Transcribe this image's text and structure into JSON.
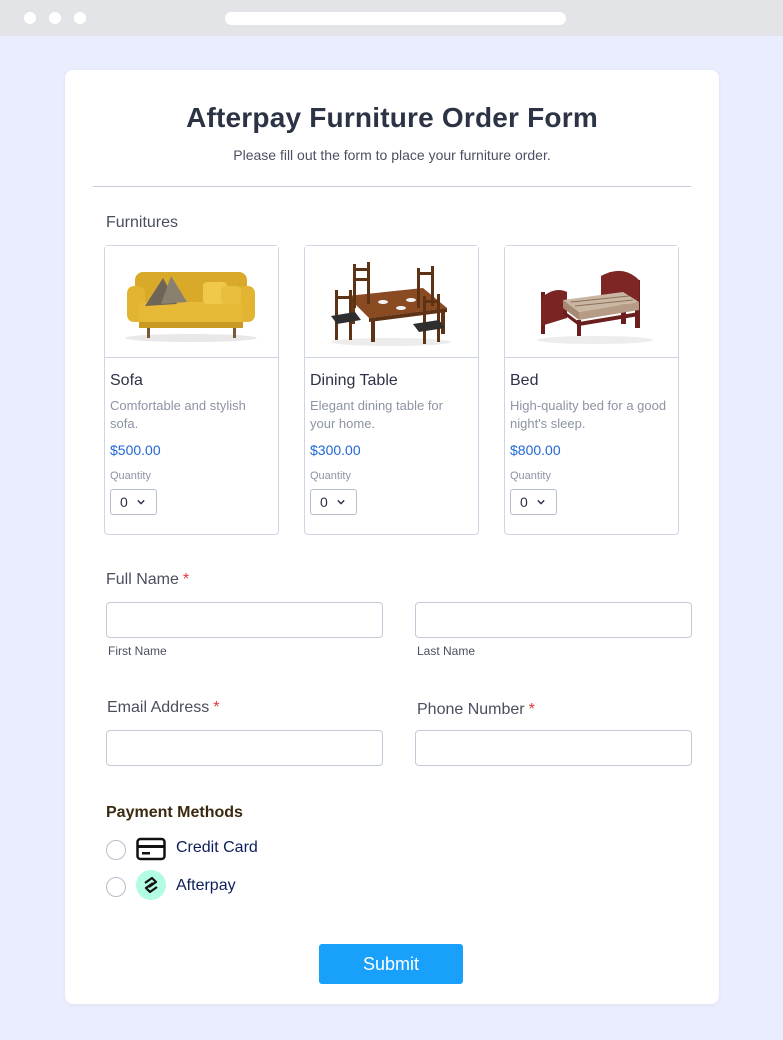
{
  "form": {
    "title": "Afterpay Furniture Order Form",
    "subtitle": "Please fill out the form to place your furniture order.",
    "furnitures_label": "Furnitures",
    "products": [
      {
        "name": "Sofa",
        "description": "Comfortable and stylish sofa.",
        "price": "$500.00",
        "quantity_label": "Quantity",
        "quantity": "0",
        "image_icon": "sofa-image"
      },
      {
        "name": "Dining Table",
        "description": "Elegant dining table for your home.",
        "price": "$300.00",
        "quantity_label": "Quantity",
        "quantity": "0",
        "image_icon": "dining-table-image"
      },
      {
        "name": "Bed",
        "description": "High-quality bed for a good night's sleep.",
        "price": "$800.00",
        "quantity_label": "Quantity",
        "quantity": "0",
        "image_icon": "bed-image"
      }
    ],
    "full_name": {
      "label": "Full Name",
      "required_mark": "*",
      "first_name": {
        "value": "",
        "sublabel": "First Name"
      },
      "last_name": {
        "value": "",
        "sublabel": "Last Name"
      }
    },
    "email": {
      "label": "Email Address",
      "required_mark": "*",
      "value": ""
    },
    "phone": {
      "label": "Phone Number",
      "required_mark": "*",
      "value": ""
    },
    "payment": {
      "label": "Payment Methods",
      "options": [
        {
          "label": "Credit Card",
          "icon": "credit-card-icon",
          "selected": false
        },
        {
          "label": "Afterpay",
          "icon": "afterpay-icon",
          "selected": false
        }
      ]
    },
    "submit_label": "Submit"
  },
  "colors": {
    "page_background": "#e9edfd",
    "price": "#2267d6",
    "required": "#e5373b",
    "submit": "#18a0fb",
    "afterpay_mint": "#b2fce4"
  }
}
